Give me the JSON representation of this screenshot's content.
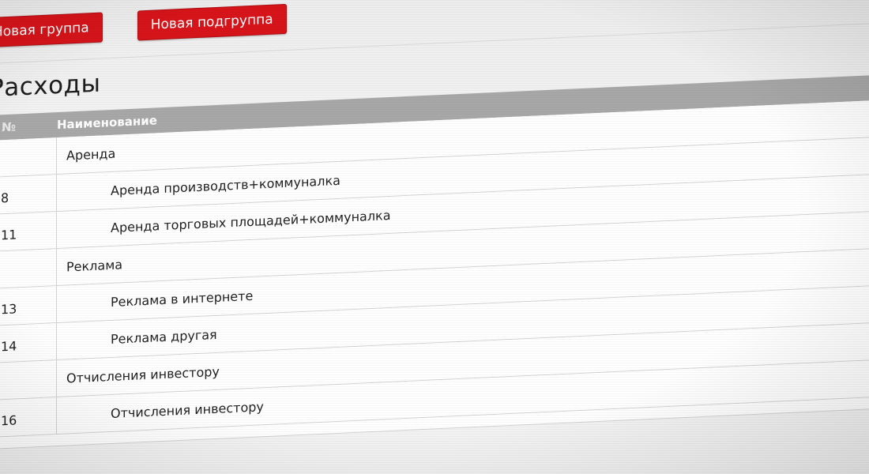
{
  "toolbar": {
    "new_group_label": "Новая группа",
    "new_subgroup_label": "Новая подгруппа"
  },
  "page": {
    "title": "Расходы"
  },
  "table": {
    "headers": {
      "num": "№",
      "name": "Наименование"
    },
    "rows": [
      {
        "type": "group",
        "num": "",
        "name": "Аренда"
      },
      {
        "type": "sub",
        "num": "8",
        "name": "Аренда производств+коммуналка"
      },
      {
        "type": "sub",
        "num": "11",
        "name": "Аренда торговых площадей+коммуналка"
      },
      {
        "type": "group",
        "num": "",
        "name": "Реклама"
      },
      {
        "type": "sub",
        "num": "13",
        "name": "Реклама в интернете"
      },
      {
        "type": "sub",
        "num": "14",
        "name": "Реклама другая"
      },
      {
        "type": "group",
        "num": "",
        "name": "Отчисления инвестору"
      },
      {
        "type": "sub",
        "num": "16",
        "name": "Отчисления инвестору"
      }
    ]
  },
  "colors": {
    "accent": "#d7141a",
    "header_bg": "#a8a8a8"
  }
}
